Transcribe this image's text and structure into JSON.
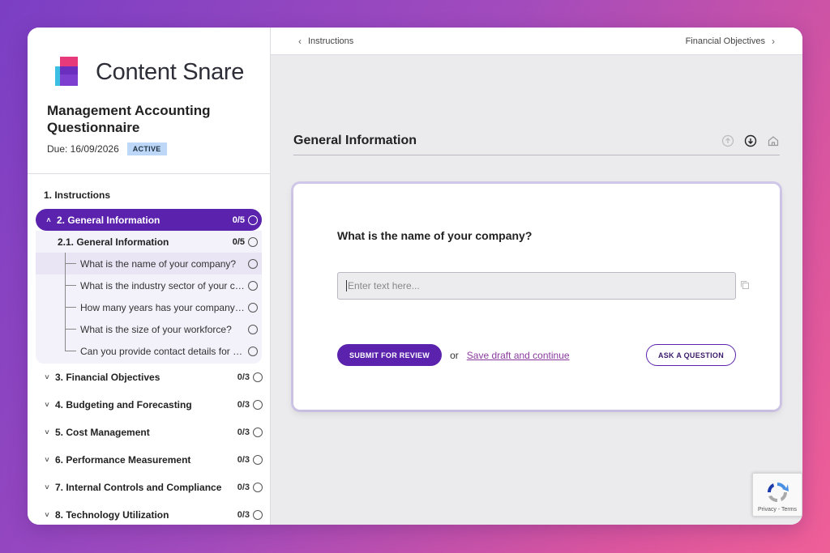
{
  "brand": {
    "name": "Content Snare"
  },
  "questionnaire": {
    "title": "Management Accounting Questionnaire",
    "due": "Due: 16/09/2026",
    "status": "ACTIVE"
  },
  "sidebar": {
    "instructions": "1. Instructions",
    "active_section": {
      "label": "2. General Information",
      "count": "0/5"
    },
    "subsection": {
      "label": "2.1. General Information",
      "count": "0/5"
    },
    "questions": [
      "What is the name of your company?",
      "What is the industry sector of your company?",
      "How many years has your company been in operation?",
      "What is the size of your workforce?",
      "Can you provide contact details for the primary contact?"
    ],
    "sections": [
      {
        "label": "3. Financial Objectives",
        "count": "0/3"
      },
      {
        "label": "4. Budgeting and Forecasting",
        "count": "0/3"
      },
      {
        "label": "5. Cost Management",
        "count": "0/3"
      },
      {
        "label": "6. Performance Measurement",
        "count": "0/3"
      },
      {
        "label": "7. Internal Controls and Compliance",
        "count": "0/3"
      },
      {
        "label": "8. Technology Utilization",
        "count": "0/3"
      }
    ]
  },
  "topbar": {
    "prev": "Instructions",
    "next": "Financial Objectives"
  },
  "main": {
    "section_title": "General Information",
    "question": "What is the name of your company?",
    "answer_placeholder": "Enter text here...",
    "submit_label": "SUBMIT FOR REVIEW",
    "or_text": "or",
    "save_link": "Save draft and continue",
    "ask_label": "ASK A QUESTION"
  },
  "recaptcha": {
    "text": "Privacy - Terms"
  },
  "colors": {
    "accent": "#5b23ad",
    "badge": "#bcd7f7",
    "link": "#8a3a9e"
  }
}
